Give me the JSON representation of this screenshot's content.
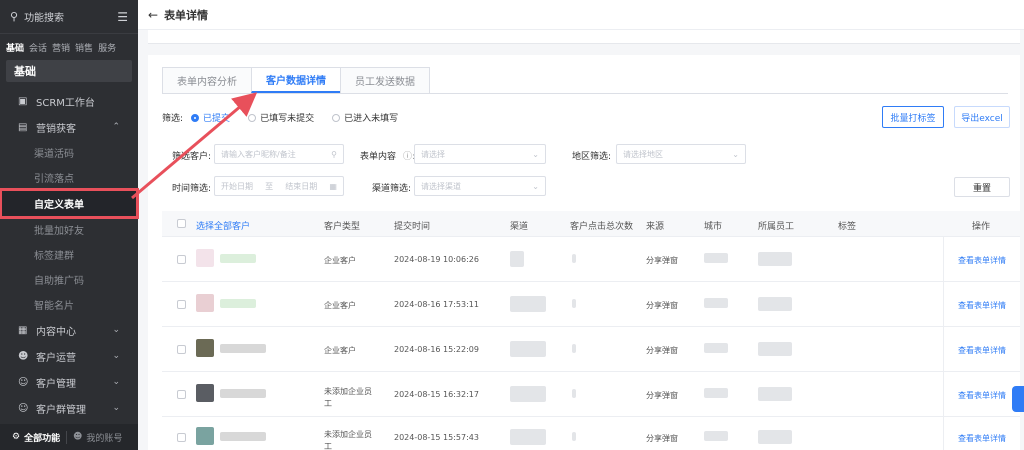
{
  "sidebar": {
    "search_text": "功能搜索",
    "tabs": [
      "基础",
      "会话",
      "营销",
      "销售",
      "服务"
    ],
    "section_title": "基础",
    "items": [
      {
        "label": "SCRM工作台"
      },
      {
        "label": "营销获客"
      }
    ],
    "sub_items": [
      "渠道活码",
      "引流落点",
      "自定义表单",
      "批量加好友",
      "标签建群",
      "自助推广码",
      "智能名片"
    ],
    "more_items": [
      {
        "label": "内容中心"
      },
      {
        "label": "客户运营"
      },
      {
        "label": "客户管理"
      },
      {
        "label": "客户群管理"
      }
    ],
    "bottom_all": "全部功能",
    "bottom_user": "我的账号"
  },
  "topbar": {
    "back_icon": "arrow-left-icon",
    "title": "表单详情"
  },
  "tabs": [
    {
      "label": "表单内容分析",
      "active": false
    },
    {
      "label": "客户数据详情",
      "active": true
    },
    {
      "label": "员工发送数据",
      "active": false
    }
  ],
  "filter": {
    "label": "筛选:",
    "options": [
      "已提交",
      "已填写未提交",
      "已进入未填写"
    ],
    "selected": "已提交"
  },
  "buttons": {
    "batch_tag": "批量打标签",
    "export": "导出excel",
    "reset": "重置"
  },
  "form": {
    "customer_label": "筛选客户:",
    "customer_placeholder": "请输入客户昵称/备注",
    "content_label": "表单内容",
    "content_placeholder": "请选择",
    "region_label": "地区筛选:",
    "region_placeholder": "请选择地区",
    "time_label": "时间筛选:",
    "time_start": "开始日期",
    "time_sep": "至",
    "time_end": "结束日期",
    "channel_label": "渠道筛选:",
    "channel_placeholder": "请选择渠道"
  },
  "table": {
    "headers": {
      "select_all": "选择全部客户",
      "type": "客户类型",
      "time": "提交时间",
      "channel": "渠道",
      "clicks": "客户点击总次数",
      "source": "来源",
      "city": "城市",
      "staff": "所属员工",
      "tag": "标签",
      "action": "操作"
    },
    "rows": [
      {
        "type": "企业客户",
        "time": "2024-08-19 10:06:26",
        "source": "分享弹窗",
        "action": "查看表单详情"
      },
      {
        "type": "企业客户",
        "time": "2024-08-16 17:53:11",
        "source": "分享弹窗",
        "action": "查看表单详情"
      },
      {
        "type": "企业客户",
        "time": "2024-08-16 15:22:09",
        "source": "分享弹窗",
        "action": "查看表单详情"
      },
      {
        "type": "未添加企业员工",
        "time": "2024-08-15 16:32:17",
        "source": "分享弹窗",
        "action": "查看表单详情"
      },
      {
        "type": "未添加企业员工",
        "time": "2024-08-15 15:57:43",
        "source": "分享弹窗",
        "action": "查看表单详情"
      }
    ]
  },
  "colors": {
    "accent": "#2f7cf6",
    "annotation": "#e8505b",
    "sidebar_bg": "#2d2f33"
  }
}
